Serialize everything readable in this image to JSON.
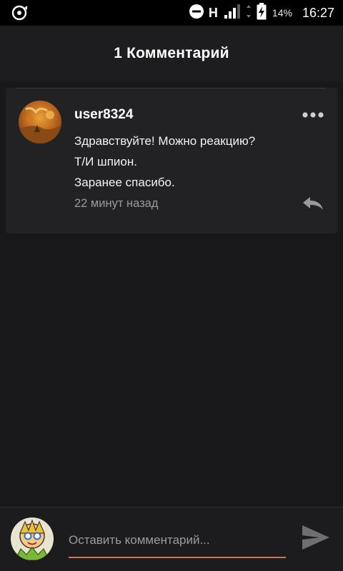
{
  "status_bar": {
    "network_type": "H",
    "battery_percent": "14%",
    "time": "16:27",
    "icons": [
      "sync-icon",
      "do-not-disturb-icon",
      "signal-icon",
      "battery-charging-icon"
    ]
  },
  "header": {
    "title": "1 Комментарий"
  },
  "comments": [
    {
      "username": "user8324",
      "lines": [
        "Здравствуйте! Можно реакцию?",
        "Т/И шпион.",
        "Заранее спасибо."
      ],
      "time_ago": "22 минут назад",
      "icons": [
        "more-icon",
        "reply-icon"
      ]
    }
  ],
  "composer": {
    "placeholder": "Оставить комментарий...",
    "icons": [
      "send-icon"
    ]
  },
  "colors": {
    "accent": "#f2673a",
    "background": "#18181a",
    "card": "#222224",
    "header": "#1d1d1f"
  }
}
